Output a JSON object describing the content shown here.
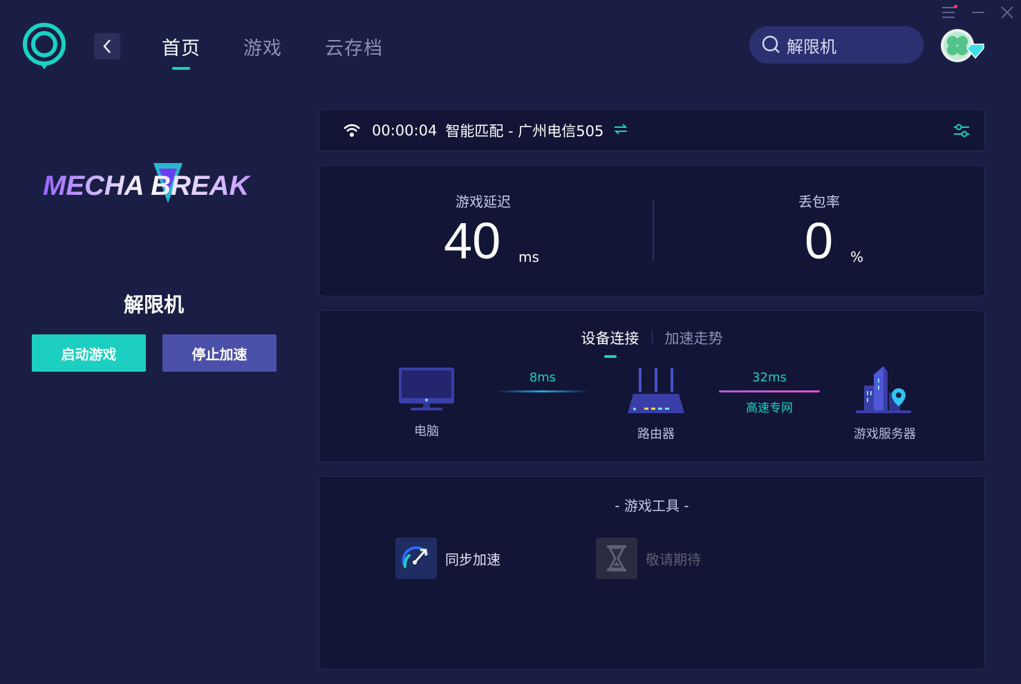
{
  "window": {
    "controls": [
      "menu-icon",
      "minimize-icon",
      "close-icon"
    ]
  },
  "header": {
    "tabs": [
      {
        "label": "首页",
        "active": true
      },
      {
        "label": "游戏",
        "active": false
      },
      {
        "label": "云存档",
        "active": false
      }
    ],
    "search": {
      "value": "解限机",
      "icon": "search-icon"
    }
  },
  "game": {
    "logo_text": "MECHA BREAK",
    "name": "解限机",
    "start_label": "启动游戏",
    "stop_label": "停止加速"
  },
  "connection": {
    "duration": "00:00:04",
    "route": "智能匹配 - 广州电信505"
  },
  "stats": {
    "latency": {
      "label": "游戏延迟",
      "value": "40",
      "unit": "ms"
    },
    "loss": {
      "label": "丢包率",
      "value": "0",
      "unit": "%"
    }
  },
  "device": {
    "tabs": [
      {
        "label": "设备连接",
        "active": true
      },
      {
        "label": "加速走势",
        "active": false
      }
    ],
    "nodes": {
      "pc": "电脑",
      "router": "路由器",
      "server": "游戏服务器"
    },
    "links": {
      "pc_router": {
        "latency": "8ms"
      },
      "router_server": {
        "latency": "32ms",
        "label": "高速专网"
      }
    }
  },
  "tools": {
    "title": "- 游戏工具 -",
    "items": [
      {
        "label": "同步加速",
        "enabled": true
      },
      {
        "label": "敬请期待",
        "enabled": false
      }
    ]
  },
  "colors": {
    "accent": "#19d2c3",
    "background": "#1a1e45",
    "card": "#121535",
    "stop_button": "#4b51a9",
    "link_purple": "#b25de0"
  }
}
